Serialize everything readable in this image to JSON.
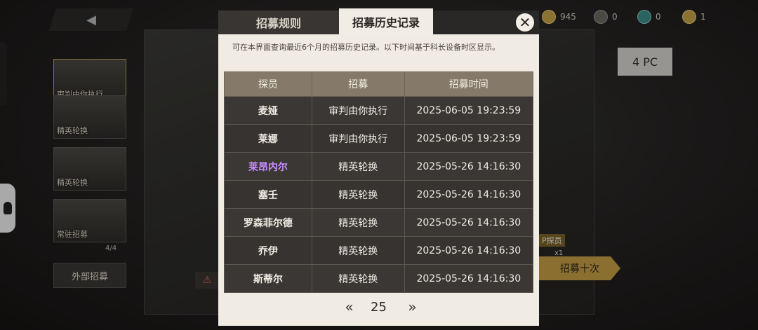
{
  "background": {
    "back_icon": "◀",
    "cards": [
      {
        "label": "审判由你执行"
      },
      {
        "label": "精英轮换"
      },
      {
        "label": "精英轮换"
      },
      {
        "label": "常驻招募"
      }
    ],
    "count": "4/4",
    "external_label": "外部招募",
    "currencies": [
      {
        "value": "945"
      },
      {
        "value": "0"
      },
      {
        "value": "0"
      },
      {
        "value": "1"
      }
    ],
    "corner_text": "4 PC",
    "tag_text": "P探员",
    "x1_text": "x1",
    "ten_pull_label": "招募十次",
    "warn_icon": "⚠"
  },
  "modal": {
    "tabs": [
      {
        "label": "招募规则",
        "active": false
      },
      {
        "label": "招募历史记录",
        "active": true
      }
    ],
    "close_icon": "✕",
    "description": "可在本界面查询最近6个月的招募历史记录。以下时间基于科长设备时区显示。",
    "table": {
      "headers": [
        "探员",
        "招募",
        "招募时间"
      ],
      "rows": [
        {
          "agent": "麦娅",
          "pool": "审判由你执行",
          "time": "2025-06-05 19:23:59",
          "color": "#f1ede5"
        },
        {
          "agent": "莱娜",
          "pool": "审判由你执行",
          "time": "2025-06-05 19:23:59",
          "color": "#f1ede5"
        },
        {
          "agent": "莱昂内尔",
          "pool": "精英轮换",
          "time": "2025-05-26 14:16:30",
          "color": "#c68cff"
        },
        {
          "agent": "塞壬",
          "pool": "精英轮换",
          "time": "2025-05-26 14:16:30",
          "color": "#f1ede5"
        },
        {
          "agent": "罗森菲尔德",
          "pool": "精英轮换",
          "time": "2025-05-26 14:16:30",
          "color": "#f1ede5"
        },
        {
          "agent": "乔伊",
          "pool": "精英轮换",
          "time": "2025-05-26 14:16:30",
          "color": "#f1ede5"
        },
        {
          "agent": "斯蒂尔",
          "pool": "精英轮换",
          "time": "2025-05-26 14:16:30",
          "color": "#f1ede5"
        }
      ]
    },
    "pager": {
      "prev_icon": "«",
      "page": "25",
      "next_icon": "»"
    }
  }
}
